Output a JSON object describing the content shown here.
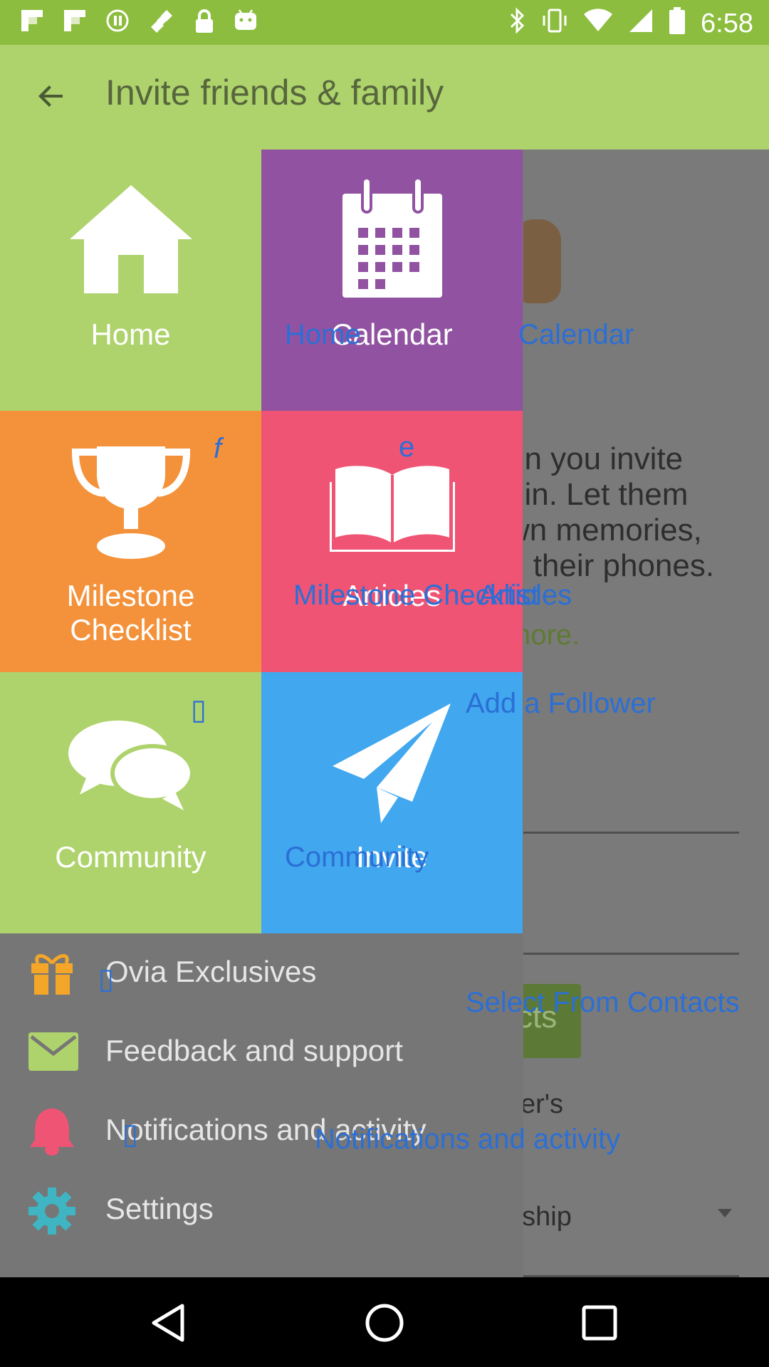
{
  "status_bar": {
    "time": "6:58",
    "left_icons": [
      "flipboard-icon",
      "flipboard-icon",
      "record-icon",
      "satellite-icon",
      "lock-icon",
      "android-icon"
    ],
    "right_icons": [
      "bluetooth-icon",
      "vibrate-icon",
      "wifi-icon",
      "signal-icon",
      "battery-icon"
    ]
  },
  "app_bar": {
    "title": "Invite friends & family",
    "back_icon": "arrow-left-icon"
  },
  "drawer": {
    "tiles": [
      {
        "label": "Home",
        "icon": "house-icon",
        "color": "#aed36c"
      },
      {
        "label": "Calendar",
        "icon": "calendar-icon",
        "color": "#9153a1"
      },
      {
        "label": "Milestone\nChecklist",
        "icon": "trophy-icon",
        "color": "#f4923b"
      },
      {
        "label": "Articles",
        "icon": "book-icon",
        "color": "#ef5474"
      },
      {
        "label": "Community",
        "icon": "chat-bubbles-icon",
        "color": "#aed36c"
      },
      {
        "label": "Invite",
        "icon": "paper-plane-icon",
        "color": "#41a7ee"
      }
    ],
    "menu": [
      {
        "label": "Ovia Exclusives",
        "icon": "gift-icon"
      },
      {
        "label": "Feedback and support",
        "icon": "envelope-icon"
      },
      {
        "label": "Notifications and activity",
        "icon": "bell-icon"
      },
      {
        "label": "Settings",
        "icon": "gear-icon"
      }
    ]
  },
  "background": {
    "paragraph": "en you invite\noin. Let them\nwn memories,\nn their phones.",
    "more": "more.",
    "button_text": "cts",
    "followers_label": "ver's",
    "relationship": "nship"
  },
  "ghost_labels": {
    "home": "Home",
    "calendar": "Calendar",
    "milestone": "Milestone Checklist",
    "articles": "Articles",
    "community": "Community",
    "add_follower": "Add a Follower",
    "select_contacts": "Select From Contacts",
    "notifications": "Notifications and activity",
    "f_glyph": "f",
    "e_glyph": "e",
    "box_glyph": "▯"
  },
  "colors": {
    "status_bar": "#8cbd3e",
    "app_bar": "#aed36c",
    "menu_bg": "#767676",
    "gift": "#f4a629",
    "envelope": "#aed36c",
    "bell": "#ef5474",
    "gear": "#3fb5c4"
  }
}
